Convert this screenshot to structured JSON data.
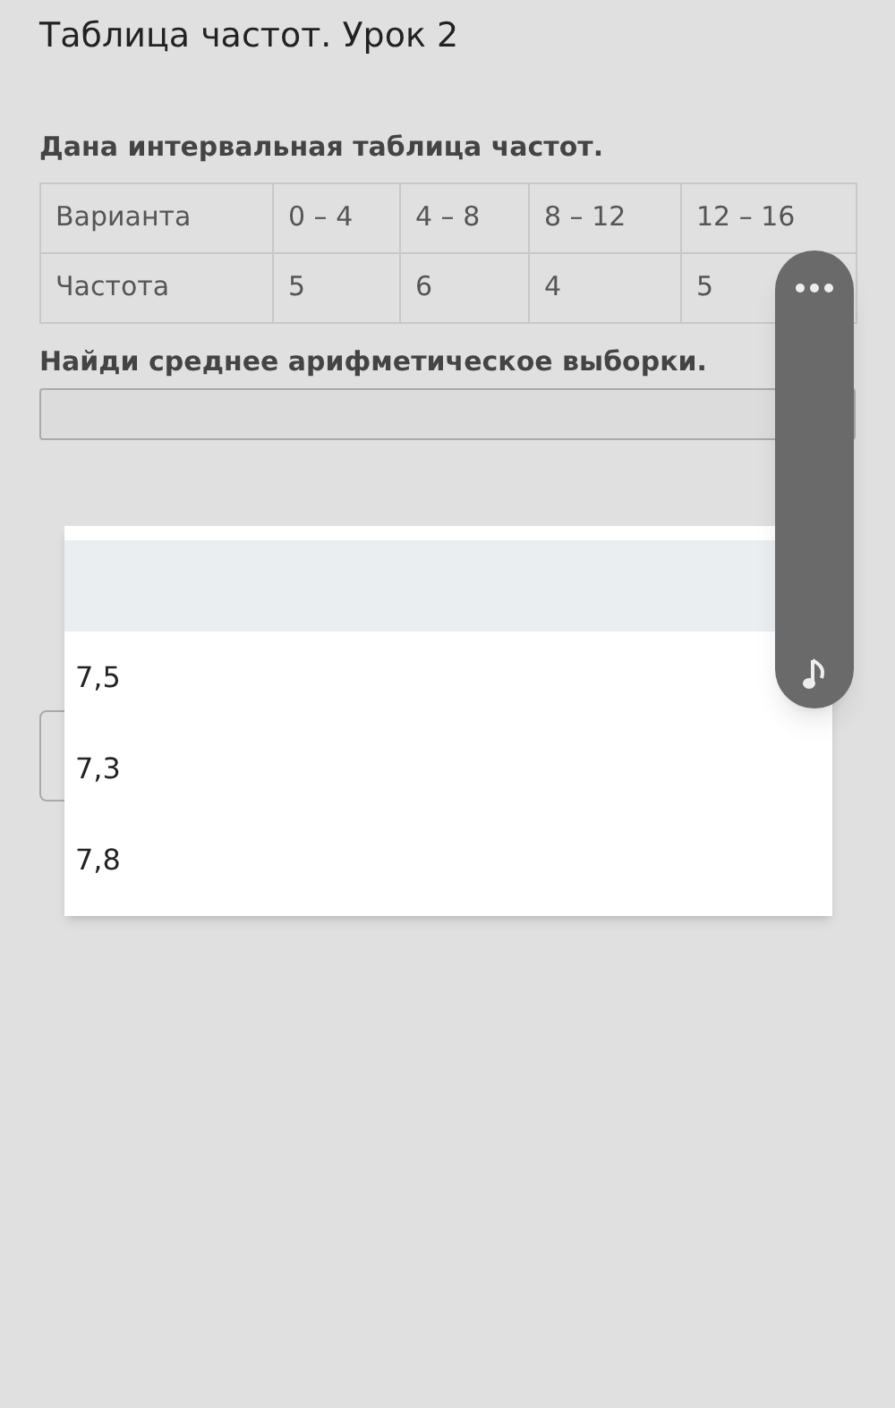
{
  "title": "Таблица частот. Урок 2",
  "prompt": "Дана интервальная таблица частот.",
  "table": {
    "rows": [
      [
        "Варианта",
        "0 – 4",
        "4 – 8",
        "8 – 12",
        "12 – 16"
      ],
      [
        "Частота",
        "5",
        "6",
        "4",
        "5"
      ]
    ]
  },
  "question": "Найди среднее арифметическое выборки.",
  "dropdown": {
    "expanded": true,
    "options": [
      {
        "selected": true
      },
      {
        "label": "7,5",
        "selected": false
      },
      {
        "label": "7,3",
        "selected": false
      },
      {
        "label": "7,8",
        "selected": false
      }
    ]
  }
}
